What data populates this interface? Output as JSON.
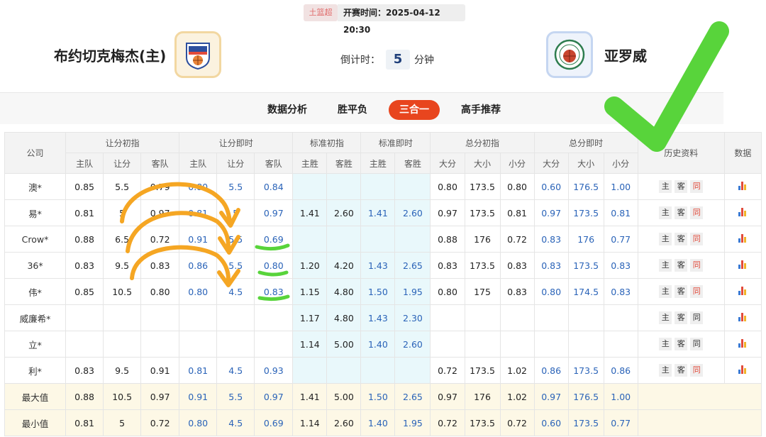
{
  "header": {
    "league": "土篮超",
    "start_time": "开赛时间：2025-04-12 20:30",
    "home_team": "布约切克梅杰(主)",
    "away_team": "亚罗威",
    "countdown_label": "倒计时：",
    "countdown_value": "5",
    "countdown_unit": "分钟"
  },
  "tabs": [
    "数据分析",
    "胜平负",
    "三合一",
    "高手推荐"
  ],
  "active_tab": "三合一",
  "table": {
    "group_headers": {
      "company": "公司",
      "hcp_init": "让分初指",
      "hcp_live": "让分即时",
      "std_init": "标准初指",
      "std_live": "标准即时",
      "tot_init": "总分初指",
      "tot_live": "总分即时",
      "history": "历史资料",
      "data": "数据"
    },
    "sub_headers": {
      "home": "主队",
      "spread": "让分",
      "away": "客队",
      "home_win": "主胜",
      "away_win": "客胜",
      "big": "大分",
      "size": "大小",
      "small": "小分"
    },
    "history_buttons": [
      "主",
      "客",
      "同"
    ],
    "rows": [
      {
        "company": "澳*",
        "hi": [
          "0.85",
          "5.5",
          "0.79"
        ],
        "hl": [
          "0.80",
          "5.5",
          "0.84"
        ],
        "si": [
          "",
          ""
        ],
        "sl": [
          "",
          ""
        ],
        "ti": [
          "0.80",
          "173.5",
          "0.80"
        ],
        "tl": [
          "0.60",
          "176.5",
          "1.00"
        ],
        "same_red": true
      },
      {
        "company": "易*",
        "hi": [
          "0.81",
          "5",
          "0.97"
        ],
        "hl": [
          "0.81",
          "5",
          "0.97"
        ],
        "si": [
          "1.41",
          "2.60"
        ],
        "sl": [
          "1.41",
          "2.60"
        ],
        "ti": [
          "0.97",
          "173.5",
          "0.81"
        ],
        "tl": [
          "0.97",
          "173.5",
          "0.81"
        ],
        "same_red": true
      },
      {
        "company": "Crow*",
        "hi": [
          "0.88",
          "6.5",
          "0.72"
        ],
        "hl": [
          "0.91",
          "5.5",
          "0.69"
        ],
        "si": [
          "",
          ""
        ],
        "sl": [
          "",
          ""
        ],
        "ti": [
          "0.88",
          "176",
          "0.72"
        ],
        "tl": [
          "0.83",
          "176",
          "0.77"
        ],
        "same_red": true
      },
      {
        "company": "36*",
        "hi": [
          "0.83",
          "9.5",
          "0.83"
        ],
        "hl": [
          "0.86",
          "5.5",
          "0.80"
        ],
        "si": [
          "1.20",
          "4.20"
        ],
        "sl": [
          "1.43",
          "2.65"
        ],
        "ti": [
          "0.83",
          "173.5",
          "0.83"
        ],
        "tl": [
          "0.83",
          "173.5",
          "0.83"
        ],
        "same_red": true
      },
      {
        "company": "伟*",
        "hi": [
          "0.85",
          "10.5",
          "0.80"
        ],
        "hl": [
          "0.80",
          "4.5",
          "0.83"
        ],
        "si": [
          "1.15",
          "4.80"
        ],
        "sl": [
          "1.50",
          "1.95"
        ],
        "ti": [
          "0.80",
          "175",
          "0.83"
        ],
        "tl": [
          "0.80",
          "174.5",
          "0.83"
        ],
        "same_red": true
      },
      {
        "company": "威廉希*",
        "hi": [
          "",
          "",
          ""
        ],
        "hl": [
          "",
          "",
          ""
        ],
        "si": [
          "1.17",
          "4.80"
        ],
        "sl": [
          "1.43",
          "2.30"
        ],
        "ti": [
          "",
          "",
          ""
        ],
        "tl": [
          "",
          "",
          ""
        ],
        "same_red": false
      },
      {
        "company": "立*",
        "hi": [
          "",
          "",
          ""
        ],
        "hl": [
          "",
          "",
          ""
        ],
        "si": [
          "1.14",
          "5.00"
        ],
        "sl": [
          "1.40",
          "2.60"
        ],
        "ti": [
          "",
          "",
          ""
        ],
        "tl": [
          "",
          "",
          ""
        ],
        "same_red": false
      },
      {
        "company": "利*",
        "hi": [
          "0.83",
          "9.5",
          "0.91"
        ],
        "hl": [
          "0.81",
          "4.5",
          "0.93"
        ],
        "si": [
          "",
          ""
        ],
        "sl": [
          "",
          ""
        ],
        "ti": [
          "0.72",
          "173.5",
          "1.02"
        ],
        "tl": [
          "0.86",
          "173.5",
          "0.86"
        ],
        "same_red": true
      }
    ],
    "summary_rows": [
      {
        "company": "最大值",
        "hi": [
          "0.88",
          "10.5",
          "0.97"
        ],
        "hl": [
          "0.91",
          "5.5",
          "0.97"
        ],
        "si": [
          "1.41",
          "5.00"
        ],
        "sl": [
          "1.50",
          "2.65"
        ],
        "ti": [
          "0.97",
          "176",
          "1.02"
        ],
        "tl": [
          "0.97",
          "176.5",
          "1.00"
        ]
      },
      {
        "company": "最小值",
        "hi": [
          "0.81",
          "5",
          "0.72"
        ],
        "hl": [
          "0.80",
          "4.5",
          "0.69"
        ],
        "si": [
          "1.14",
          "2.60"
        ],
        "sl": [
          "1.40",
          "1.95"
        ],
        "ti": [
          "0.72",
          "173.5",
          "0.72"
        ],
        "tl": [
          "0.60",
          "173.5",
          "0.77"
        ]
      }
    ]
  },
  "colors": {
    "accent": "#e8451e",
    "live_value": "#2a63b8",
    "standard_bg": "#e9f8fb",
    "summary_bg": "#fdf8e6",
    "annotation_orange": "#f5a623",
    "annotation_green": "#58d43b"
  }
}
